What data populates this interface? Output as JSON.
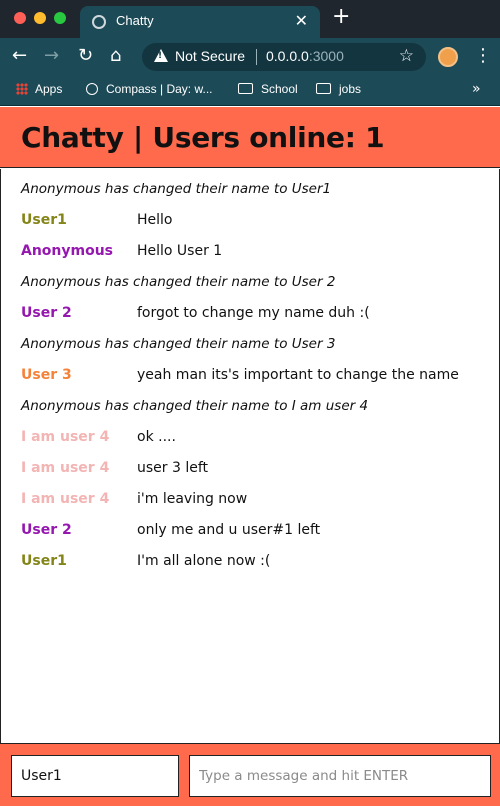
{
  "browser": {
    "tab_title": "Chatty",
    "tab_close": "✕",
    "new_tab": "+",
    "security_label": "Not Secure",
    "url_host": "0.0.0.0",
    "url_port": ":3000",
    "bookmarks": {
      "apps": "Apps",
      "compass": "Compass | Day: w...",
      "school": "School",
      "jobs": "jobs",
      "more": "»"
    }
  },
  "header": {
    "title": "Chatty | Users online: 1"
  },
  "messages": [
    {
      "type": "notice",
      "text": "Anonymous has changed their name to User1"
    },
    {
      "type": "message",
      "username": "User1",
      "content": "Hello",
      "color": "#848519"
    },
    {
      "type": "message",
      "username": "Anonymous",
      "content": "Hello User 1",
      "color": "#9517b0"
    },
    {
      "type": "notice",
      "text": "Anonymous has changed their name to User 2"
    },
    {
      "type": "message",
      "username": "User 2",
      "content": "forgot to change my name duh :(",
      "color": "#9517b0"
    },
    {
      "type": "notice",
      "text": "Anonymous has changed their name to User 3"
    },
    {
      "type": "message",
      "username": "User 3",
      "content": "yeah man its's important to change the name",
      "color": "#f48339"
    },
    {
      "type": "notice",
      "text": "Anonymous has changed their name to I am user 4"
    },
    {
      "type": "message",
      "username": "I am user 4",
      "content": "ok ....",
      "color": "#f3b4b4"
    },
    {
      "type": "message",
      "username": "I am user 4",
      "content": "user 3 left",
      "color": "#f3b4b4"
    },
    {
      "type": "message",
      "username": "I am user 4",
      "content": "i'm leaving now",
      "color": "#f3b4b4"
    },
    {
      "type": "message",
      "username": "User 2",
      "content": "only me and u user#1 left",
      "color": "#9517b0"
    },
    {
      "type": "message",
      "username": "User1",
      "content": "I'm all alone now :(",
      "color": "#848519"
    }
  ],
  "footer": {
    "username_value": "User1",
    "message_placeholder": "Type a message and hit ENTER"
  },
  "colors": {
    "accent": "#ff6a4d",
    "browser_chrome": "#1d4a57"
  }
}
